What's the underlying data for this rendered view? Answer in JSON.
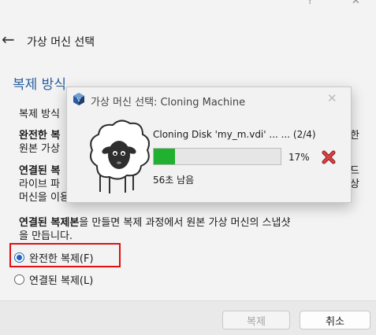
{
  "window": {
    "help_glyph": "?",
    "close_glyph": "✕"
  },
  "header": {
    "back_glyph": "←",
    "title": "가상 머신 선택"
  },
  "section": {
    "heading": "복제 방식"
  },
  "body": {
    "line1": "복제 방식",
    "line2_bold": "완전한 복",
    "line2_tail": "한",
    "line3": "원본 가상",
    "line4_bold": "연결된 복",
    "line4_tail": "드",
    "line5": "라이브 파",
    "line5_tail": "상",
    "line6": "머신을 이용할 때에도 원래 가상 머신과 함께 이동해야 합니다.",
    "line7_bold": "연결된 복제본",
    "line7_rest": "을 만들면 복제 과정에서 원본 가상 머신의 스냅샷",
    "line8": "을 만듭니다."
  },
  "options": {
    "full_clone": "완전한 복제(F)",
    "linked_clone": "연결된 복제(L)",
    "selected": "full_clone"
  },
  "footer": {
    "clone_label": "복제",
    "cancel_label": "취소"
  },
  "progress_dialog": {
    "title": "가상 머신 선택: Cloning Machine",
    "close_glyph": "✕",
    "status": "Cloning Disk 'my_m.vdi' ... ... (2/4)",
    "percent_label": "17%",
    "percent_value": 0.17,
    "remaining": "56초 남음"
  },
  "colors": {
    "accent": "#1f64b8",
    "progress": "#1fb12f",
    "highlight": "#e01010"
  }
}
